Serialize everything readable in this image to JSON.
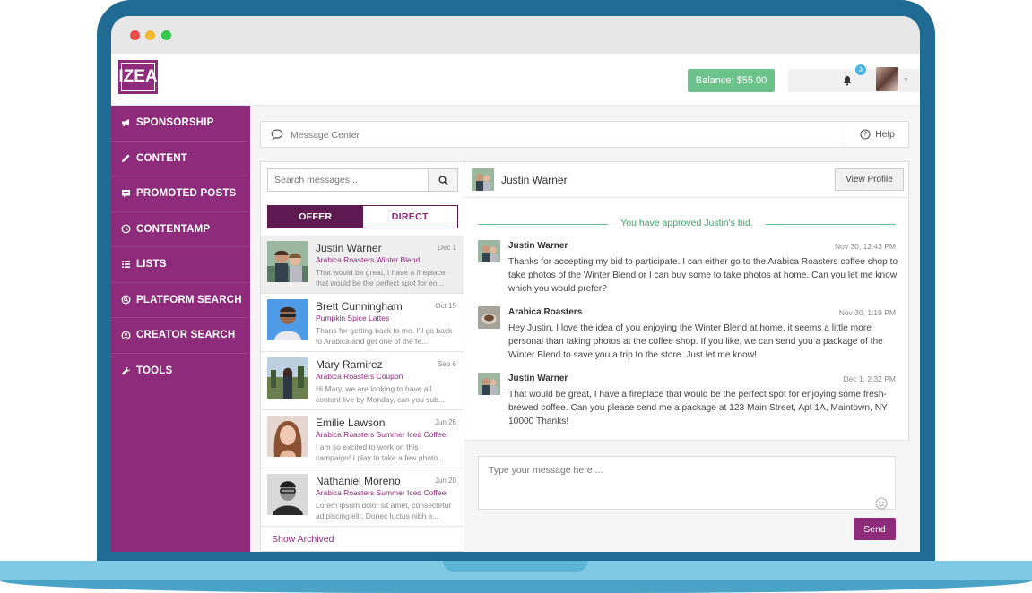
{
  "topbar": {
    "logo_text": "IZEA",
    "balance_label": "Balance: $55.00",
    "messages_badge": "2",
    "notifications_badge": "3"
  },
  "sidebar": {
    "items": [
      {
        "label": "SPONSORSHIP",
        "icon": "megaphone-icon"
      },
      {
        "label": "CONTENT",
        "icon": "pencil-icon"
      },
      {
        "label": "PROMOTED POSTS",
        "icon": "promoted-icon"
      },
      {
        "label": "CONTENTAMP",
        "icon": "clock-icon"
      },
      {
        "label": "LISTS",
        "icon": "list-icon"
      },
      {
        "label": "PLATFORM SEARCH",
        "icon": "search-circle-icon"
      },
      {
        "label": "CREATOR SEARCH",
        "icon": "user-circle-icon"
      },
      {
        "label": "TOOLS",
        "icon": "wrench-icon"
      }
    ]
  },
  "message_center": {
    "title": "Message Center",
    "help_label": "Help"
  },
  "list": {
    "search_placeholder": "Search messages...",
    "tabs": [
      "OFFER",
      "DIRECT"
    ],
    "show_archived": "Show Archived",
    "conversations": [
      {
        "name": "Justin Warner",
        "date": "Dec 1",
        "campaign": "Arabica Roasters Winter Blend",
        "preview": "That would be great, I have a fireplace that would be the perfect spot for en..."
      },
      {
        "name": "Brett Cunningham",
        "date": "Oct 15",
        "campaign": "Pumpkin Spice Lattes",
        "preview": "Thans for getting back to me. I'll go back to Arabica and get one of the fe..."
      },
      {
        "name": "Mary Ramirez",
        "date": "Sep 6",
        "campaign": "Arabica Roasters Coupon",
        "preview": "Hi Mary, we are looking to have all content live by Monday, can you sub..."
      },
      {
        "name": "Emilie Lawson",
        "date": "Jun 26",
        "campaign": "Arabica Roasters Summer Iced Coffee",
        "preview": "I am so excited to work on this campaign! I play to take a few photo..."
      },
      {
        "name": "Nathaniel Moreno",
        "date": "Jun 20",
        "campaign": "Arabica Roasters Summer Iced Coffee",
        "preview": "Lorem ipsum dolor sit amet, consectetur adipiscing elit. Donec luctus nibh e..."
      }
    ]
  },
  "chat": {
    "contact_name": "Justin Warner",
    "view_profile_label": "View Profile",
    "approved_text": "You have approved Justin's bid.",
    "messages": [
      {
        "sender": "Justin Warner",
        "time": "Nov 30, 12:43 PM",
        "text": "Thanks for accepting my bid to participate. I can either go to the Arabica Roasters coffee shop to take photos of the Winter Blend or I can buy some to take photos at home. Can you let me know which you would prefer?"
      },
      {
        "sender": "Arabica Roasters",
        "time": "Nov 30, 1:19 PM",
        "text": "Hey Justin, I love the idea of you enjoying the Winter Blend at home, it seems a little more personal than taking photos at the coffee shop. If you like, we can send you a package of the Winter Blend to save you a trip to the store. Just let me know!"
      },
      {
        "sender": "Justin Warner",
        "time": "Dec 1, 2:32 PM",
        "text": "That would be great, I have a fireplace that would be the perfect spot for enjoying some fresh-brewed coffee. Can you please send me a package at 123 Main Street, Apt 1A, Maintown, NY 10000 Thanks!"
      }
    ],
    "compose_placeholder": "Type your message here ...",
    "send_label": "Send"
  },
  "colors": {
    "brand": "#8e2b7b",
    "brand_dark": "#5f1a52",
    "success": "#6cc28b",
    "badge": "#4ab4e0",
    "frame": "#1f6b94"
  }
}
